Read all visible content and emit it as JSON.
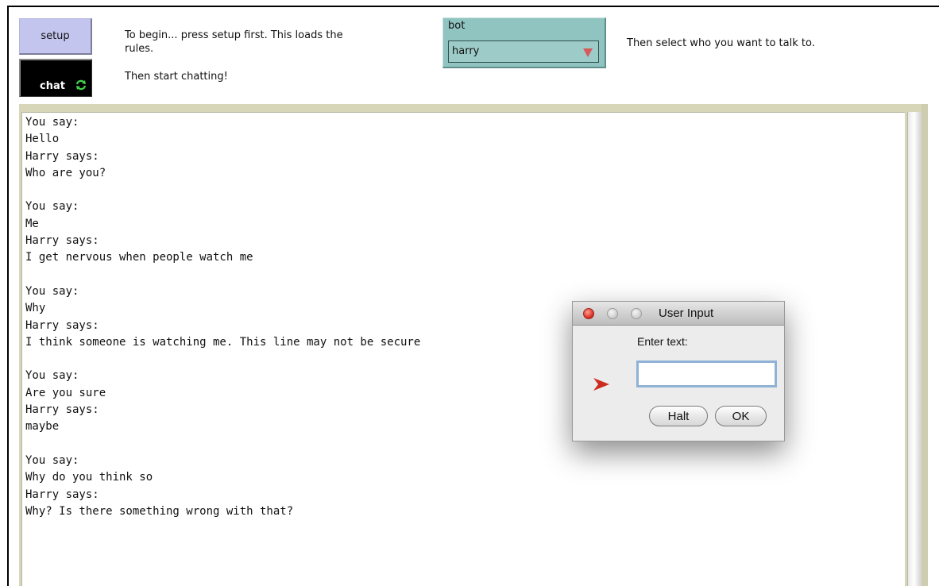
{
  "controls": {
    "setup_label": "setup",
    "chat_label": "chat",
    "chat_forever_icon": "forever-arrows-icon"
  },
  "notes": {
    "begin": "To begin... press setup first. This loads the\nrules.",
    "start": "Then start chatting!",
    "select": "Then select who you want to talk to."
  },
  "chooser": {
    "label": "bot",
    "value": "harry"
  },
  "transcript": [
    "You say:",
    "Hello",
    "Harry says:",
    "Who are you?",
    "",
    "You say:",
    "Me",
    "Harry says:",
    "I get nervous when people watch me",
    "",
    "You say:",
    "Why",
    "Harry says:",
    "I think someone is watching me. This line may not be secure",
    "",
    "You say:",
    "Are you sure",
    "Harry says:",
    "maybe",
    "",
    "You say:",
    "Why do you think so",
    "Harry says:",
    "Why? Is there something wrong with that?"
  ],
  "dialog": {
    "title": "User Input",
    "prompt": "Enter text:",
    "input_value": "",
    "halt_label": "Halt",
    "ok_label": "OK"
  },
  "colors": {
    "setup_button": "#c4c5ee",
    "chat_button": "#000000",
    "chooser": "#8fc4c0",
    "chooser_arrow": "#d65a5a",
    "pointer": "#cc2b1f",
    "forever_icon": "#3fd24a"
  }
}
